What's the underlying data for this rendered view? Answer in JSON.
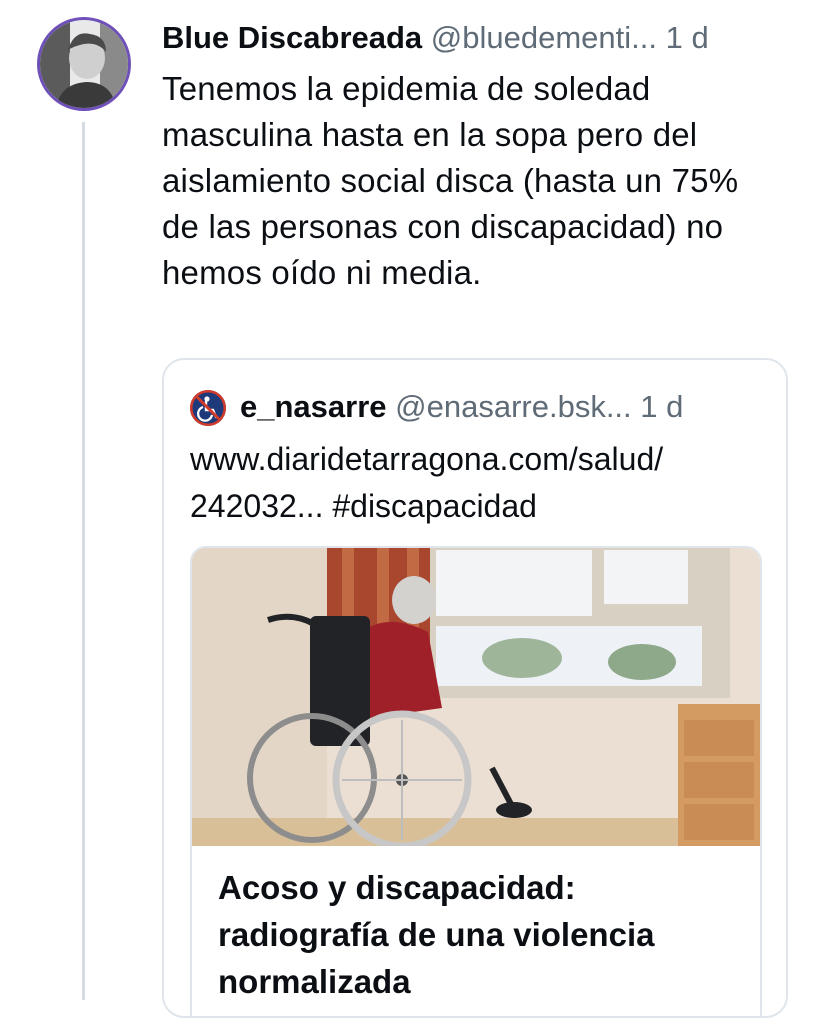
{
  "post": {
    "author": "Blue Discabreada",
    "handle": "@bluedementi...",
    "time": "1 d",
    "text": "Tenemos la epidemia de soledad masculina hasta en la sopa pero del aislamiento social disca (hasta un 75% de las personas con discapacidad) no hemos oído ni media.",
    "avatar_icon": "avatar-photo-icon"
  },
  "quote": {
    "author": "e_nasarre",
    "handle": "@enasarre.bsk...",
    "time": "1 d",
    "text": "www.diaridetarragona.com/salud/ 242032... #discapacidad",
    "avatar_icon": "accessibility-icon",
    "link_card": {
      "title": "Acoso y discapacidad: radiografía de una violencia normalizada",
      "image_icon": "wheelchair-photo"
    }
  },
  "colors": {
    "text": "#0b0f14",
    "muted": "#5f6b76",
    "border": "#dfe5ea",
    "thread": "#d4dbe2"
  }
}
